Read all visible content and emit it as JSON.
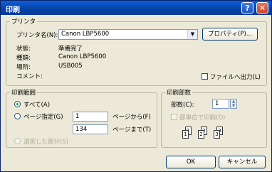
{
  "dialog": {
    "title": "印刷"
  },
  "titlebar": {
    "help": "?",
    "close": "✕"
  },
  "printer": {
    "group": "プリンタ",
    "name_label": "プリンタ名(N):",
    "name_value": "Canon LBP5600",
    "properties_button": "プロパティ(P)...",
    "status_label": "状態:",
    "status_value": "準備完了",
    "type_label": "種類:",
    "type_value": "Canon LBP5600",
    "where_label": "場所:",
    "where_value": "USB005",
    "comment_label": "コメント:",
    "print_to_file": "ファイルへ出力(L)"
  },
  "range": {
    "group": "印刷範囲",
    "all": "すべて(A)",
    "pages": "ページ指定(G)",
    "from_value": "1",
    "from_label": "ページから(F)",
    "to_value": "134",
    "to_label": "ページまで(T)",
    "selection": "選択した部分(S)"
  },
  "copies": {
    "group": "印刷部数",
    "count_label": "部数(C):",
    "count_value": "1",
    "collate": "部単位で印刷(O)"
  },
  "buttons": {
    "ok": "OK",
    "cancel": "キャンセル"
  }
}
